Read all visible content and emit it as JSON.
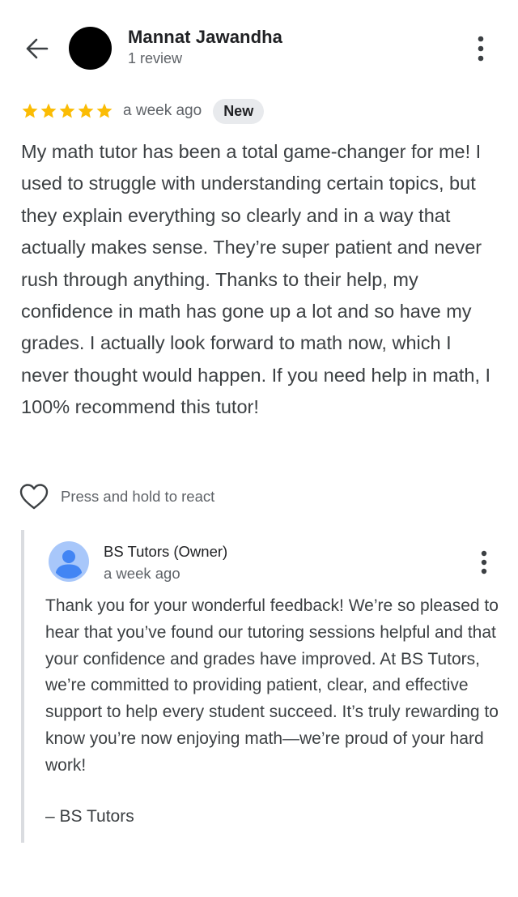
{
  "header": {
    "reviewer_name": "Mannat Jawandha",
    "review_count": "1 review"
  },
  "review": {
    "rating": 5,
    "max_rating": 5,
    "star_color": "#fbbc04",
    "date": "a week ago",
    "badge": "New",
    "text": "My math tutor has been a total game-changer for me! I used to struggle with understanding certain topics, but they explain everything so clearly and in a way that actually makes sense. They’re super patient and never rush through anything. Thanks to their help, my confidence in math has gone up a lot and so have my grades. I actually look forward to math now, which I never thought would happen. If you need help in math, I 100% recommend this tutor!"
  },
  "reaction": {
    "label": "Press and hold to react"
  },
  "owner_reply": {
    "name": "BS Tutors (Owner)",
    "date": "a week ago",
    "avatar_color": "#a8c7fa",
    "avatar_figure_color": "#4285f4",
    "text": "Thank you for your wonderful feedback! We’re so pleased to hear that you’ve found our tutoring sessions helpful and that your confidence and grades have improved. At BS Tutors, we’re committed to providing patient, clear, and effective support to help every student succeed. It’s truly rewarding to know you’re now enjoying math—we’re proud of your hard work!",
    "signature": "– BS Tutors"
  }
}
